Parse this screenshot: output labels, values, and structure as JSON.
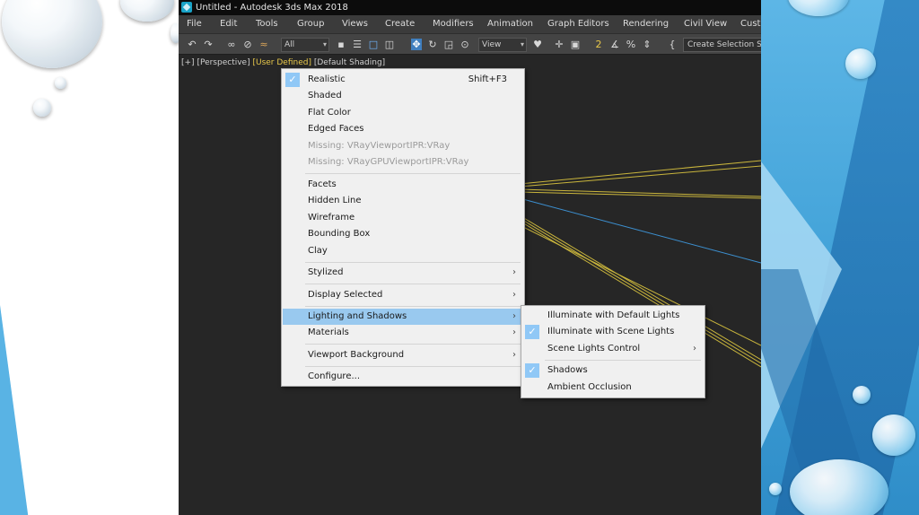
{
  "window": {
    "title": "Untitled - Autodesk 3ds Max 2018"
  },
  "menubar": {
    "items": [
      "File",
      "Edit",
      "Tools",
      "Group",
      "Views",
      "Create",
      "Modifiers",
      "Animation",
      "Graph Editors",
      "Rendering",
      "Civil View",
      "Custo"
    ]
  },
  "toolbar": {
    "filter_value": "All",
    "view_value": "View",
    "selection_set_placeholder": "Create Selection Se",
    "icons": [
      "undo-icon",
      "redo-icon",
      "link-icon",
      "unlink-icon",
      "bind-spacewarp-icon",
      "select-object-icon",
      "select-by-name-icon",
      "rectangle-region-icon",
      "window-crossing-icon",
      "move-icon",
      "rotate-icon",
      "scale-icon",
      "placement-icon",
      "pivot-icon",
      "snap-toggle-icon",
      "angle-snap-icon",
      "percent-snap-icon",
      "spinner-snap-icon",
      "edit-named-selection-icon"
    ]
  },
  "viewport": {
    "label_plus": "[+]",
    "label_view": "[Perspective]",
    "label_mode": "[User Defined]",
    "label_shading": "[Default Shading]"
  },
  "context_menu": {
    "items": [
      {
        "label": "Realistic",
        "shortcut": "Shift+F3",
        "checked": true
      },
      {
        "label": "Shaded"
      },
      {
        "label": "Flat Color"
      },
      {
        "label": "Edged Faces"
      },
      {
        "label": "Missing: VRayViewportIPR:VRay",
        "disabled": true
      },
      {
        "label": "Missing: VRayGPUViewportIPR:VRay",
        "disabled": true
      },
      {
        "label": "Facets"
      },
      {
        "label": "Hidden Line"
      },
      {
        "label": "Wireframe"
      },
      {
        "label": "Bounding Box"
      },
      {
        "label": "Clay"
      },
      {
        "label": "Stylized",
        "submenu": true
      },
      {
        "label": "Display Selected",
        "submenu": true
      },
      {
        "label": "Lighting and Shadows",
        "submenu": true,
        "active": true
      },
      {
        "label": "Materials",
        "submenu": true
      },
      {
        "label": "Viewport Background",
        "submenu": true
      },
      {
        "label": "Configure..."
      }
    ]
  },
  "submenu": {
    "items": [
      {
        "label": "Illuminate with Default Lights"
      },
      {
        "label": "Illuminate with Scene Lights",
        "checked": true
      },
      {
        "label": "Scene Lights Control",
        "submenu": true
      },
      {
        "label": "Shadows",
        "checked": true
      },
      {
        "label": "Ambient Occlusion"
      }
    ]
  },
  "glyphs": {
    "check": "✓",
    "submenu_arrow": "›"
  },
  "colors": {
    "menu_highlight": "#99c9ef",
    "check_background": "#90c8f6",
    "viewport_label_highlight": "#e8c84a",
    "slide_accent": "#3e9fd6"
  }
}
